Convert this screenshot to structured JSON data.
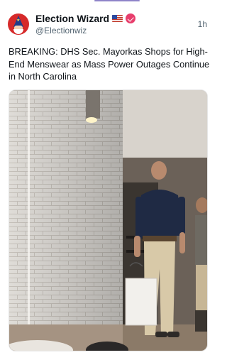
{
  "post": {
    "display_name": "Election Wizard",
    "handle": "@Electionwiz",
    "time": "1h",
    "text": "BREAKING: DHS Sec. Mayorkas Shops for High-End Menswear as Mass Power Outages Continue in North Carolina"
  },
  "icons": {
    "avatar": "wizard-avatar",
    "flag": "us-flag-icon",
    "verified": "verified-badge-icon"
  },
  "colors": {
    "verified_badge": "#e83e6c",
    "avatar_bg": "#d62a2a",
    "top_accent": "#8f84c9"
  }
}
